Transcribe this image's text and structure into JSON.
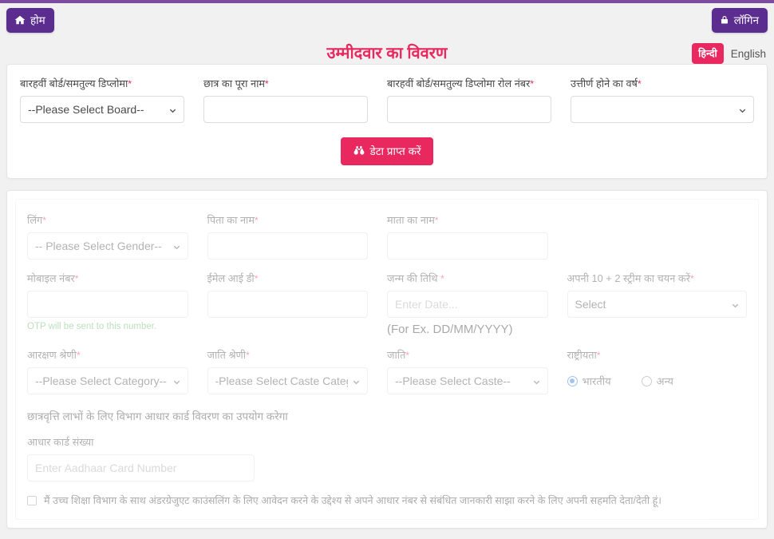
{
  "header": {
    "home_label": "होम",
    "home_icon": "home-icon",
    "login_label": "लॉगिन",
    "login_icon": "lock-icon",
    "page_title": "उम्मीदवार का विवरण",
    "lang_hindi": "हिन्दी",
    "lang_english": "English",
    "brand_purple": "#5b2d8e",
    "accent_pink": "#e8285f"
  },
  "board_card": {
    "fields": {
      "board": {
        "label": "बारहवीं बोर्ड/समतुल्य डिप्लोमा",
        "required": "*",
        "value": "--Please Select Board--"
      },
      "student_name": {
        "label": "छात्र का पूरा नाम",
        "required": "*",
        "value": "",
        "placeholder": ""
      },
      "roll_number": {
        "label": "बारहवीं बोर्ड/समतुल्य डिप्लोमा रोल नंबर",
        "required": "*",
        "value": "",
        "placeholder": ""
      },
      "passing_year": {
        "label": "उत्तीर्ण होने का वर्ष",
        "required": "*",
        "value": ""
      }
    },
    "fetch_button": {
      "label": "डेटा प्राप्त करें",
      "icon": "binoculars-icon"
    }
  },
  "details_card": {
    "fields": {
      "gender": {
        "label": "लिंग",
        "required": "*",
        "value": "-- Please Select Gender--"
      },
      "father_name": {
        "label": "पिता का नाम",
        "required": "*",
        "value": "",
        "placeholder": ""
      },
      "mother_name": {
        "label": "माता का नाम",
        "required": "*",
        "value": "",
        "placeholder": ""
      },
      "mobile": {
        "label": "मोबाइल नंबर",
        "required": "*",
        "value": "",
        "placeholder": "",
        "help": "OTP will be sent to this number.",
        "help_color": "#5fb55f"
      },
      "email": {
        "label": "ईमेल आई डी",
        "required": "*",
        "value": "",
        "placeholder": ""
      },
      "dob": {
        "label": "जन्म की तिथि",
        "required": "*",
        "value": "",
        "placeholder": "Enter Date...",
        "help": "(For Ex. DD/MM/YYYY)"
      },
      "stream": {
        "label": "अपनी 10 + 2 स्ट्रीम का चयन करें",
        "required": "*",
        "value": "Select"
      },
      "reservation_category": {
        "label": "आरक्षण श्रेणी",
        "required": "*",
        "value": "--Please Select Category--"
      },
      "caste_category": {
        "label": "जाति श्रेणी",
        "required": "*",
        "value": "-Please Select Caste Category-"
      },
      "caste": {
        "label": "जाति",
        "required": "*",
        "value": "--Please Select Caste--"
      },
      "nationality": {
        "label": "राष्ट्रीयता",
        "required": "*",
        "options": [
          {
            "label": "भारतीय",
            "selected": true
          },
          {
            "label": "अन्य",
            "selected": false
          }
        ]
      }
    },
    "aadhaar": {
      "note": "छात्रवृत्ति लाभों के लिए विभाग आधार कार्ड विवरण का उपयोग करेगा",
      "label": "आधार कार्ड संख्या",
      "value": "",
      "placeholder": "Enter Aadhaar Card Number"
    },
    "consent": {
      "checked": false,
      "text": "मैं उच्च शिक्षा विभाग के साथ अंडरग्रेजुएट काउंसलिंग के लिए आवेदन करने के उद्देश्य से अपने आधार नंबर से संबंधित जानकारी साझा करने के लिए अपनी सहमति देता/देती हूं।"
    }
  }
}
